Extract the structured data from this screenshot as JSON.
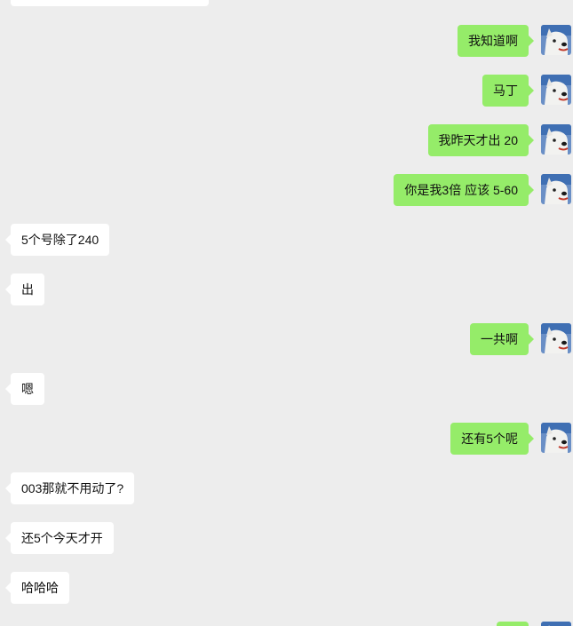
{
  "chat": {
    "messages": [
      {
        "sender": "me",
        "text": "我知道啊"
      },
      {
        "sender": "me",
        "text": "马丁"
      },
      {
        "sender": "me",
        "text": "我昨天才出 20"
      },
      {
        "sender": "me",
        "text": "你是我3倍 应该 5-60"
      },
      {
        "sender": "them",
        "text": "5个号除了240"
      },
      {
        "sender": "them",
        "text": "出"
      },
      {
        "sender": "me",
        "text": "一共啊"
      },
      {
        "sender": "them",
        "text": "嗯"
      },
      {
        "sender": "me",
        "text": "还有5个呢"
      },
      {
        "sender": "them",
        "text": "003那就不用动了?"
      },
      {
        "sender": "them",
        "text": "还5个今天才开"
      },
      {
        "sender": "them",
        "text": "哈哈哈"
      },
      {
        "sender": "me",
        "text": ""
      }
    ],
    "avatar_icon": "dog-avatar-icon",
    "colors": {
      "background": "#ededed",
      "my_bubble": "#95ec69",
      "their_bubble": "#ffffff"
    }
  }
}
